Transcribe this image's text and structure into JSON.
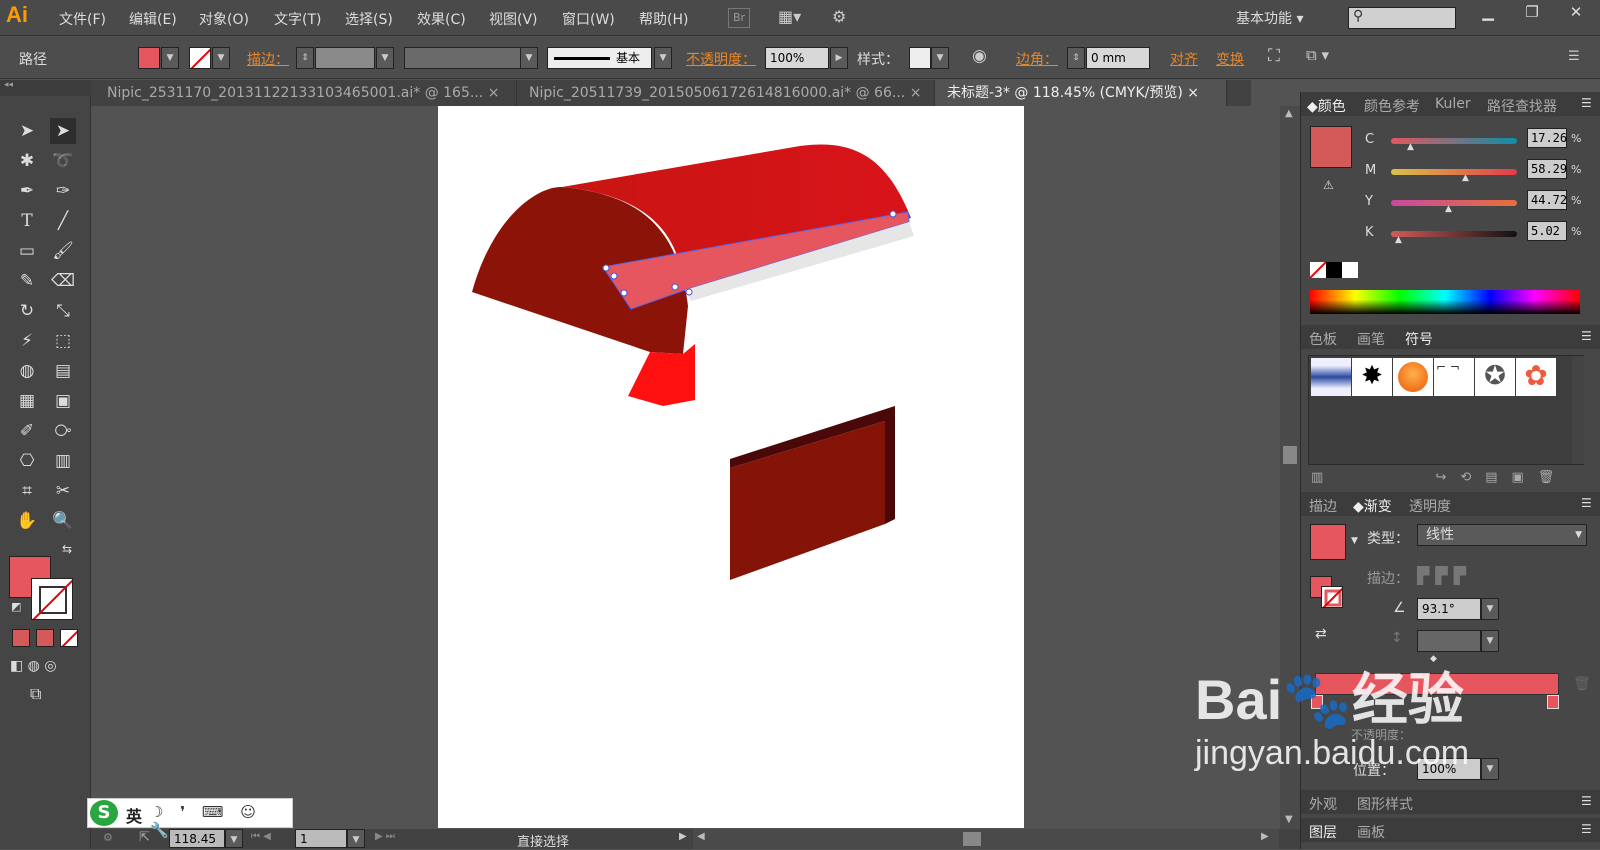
{
  "app": {
    "logo": "Ai",
    "workspace": "基本功能"
  },
  "menu": [
    "文件(F)",
    "编辑(E)",
    "对象(O)",
    "文字(T)",
    "选择(S)",
    "效果(C)",
    "视图(V)",
    "窗口(W)",
    "帮助(H)"
  ],
  "menu_extra": {
    "br": "Br"
  },
  "control": {
    "object_type": "路径",
    "stroke_label": "描边：",
    "stroke_profile": "基本",
    "opacity_label": "不透明度：",
    "opacity_value": "100%",
    "style_label": "样式：",
    "corner_label": "边角：",
    "corner_value": "0 mm",
    "align_label": "对齐",
    "transform_label": "变换"
  },
  "tabs": [
    "Nipic_2531170_20131122133103465001.ai* @ 165...",
    "Nipic_20511739_20150506172614816000.ai* @ 66...",
    "未标题-3* @ 118.45% (CMYK/预览)"
  ],
  "color_panel": {
    "tabs": [
      "颜色",
      "颜色参考",
      "Kuler",
      "路径查找器"
    ],
    "swatch": "#d45a5a",
    "channels": [
      {
        "label": "C",
        "value": "17.26",
        "pos": 0.17
      },
      {
        "label": "M",
        "value": "58.29",
        "pos": 0.58
      },
      {
        "label": "Y",
        "value": "44.72",
        "pos": 0.45
      },
      {
        "label": "K",
        "value": "5.02",
        "pos": 0.05
      }
    ],
    "unit": "%"
  },
  "symbols_panel": {
    "tabs": [
      "色板",
      "画笔",
      "符号"
    ]
  },
  "gradient_panel": {
    "tabs": [
      "描边",
      "渐变",
      "透明度"
    ],
    "type_label": "类型：",
    "type_value": "线性",
    "stroke_label": "描边：",
    "angle": "93.1°",
    "position_label": "位置：",
    "position_value": "100%",
    "opacity_label": "不透明度："
  },
  "bottom_tabs": {
    "appearance": [
      "外观",
      "图形样式"
    ],
    "layers": [
      "图层",
      "画板"
    ]
  },
  "status": {
    "zoom": "118.45",
    "page": "1",
    "tool": "直接选择"
  },
  "ime": {
    "lang": "英"
  },
  "watermark": {
    "brand": "Bai",
    "brand2": "经验",
    "url": "jingyan.baidu.com"
  },
  "colors": {
    "fill": "#e6565e",
    "accent": "#e8862a",
    "roof_dark": "#8c1308",
    "roof_light": "#d11a10",
    "roof_front": "#ff1010",
    "wall": "#851408",
    "wall_edge": "#4a0808"
  }
}
